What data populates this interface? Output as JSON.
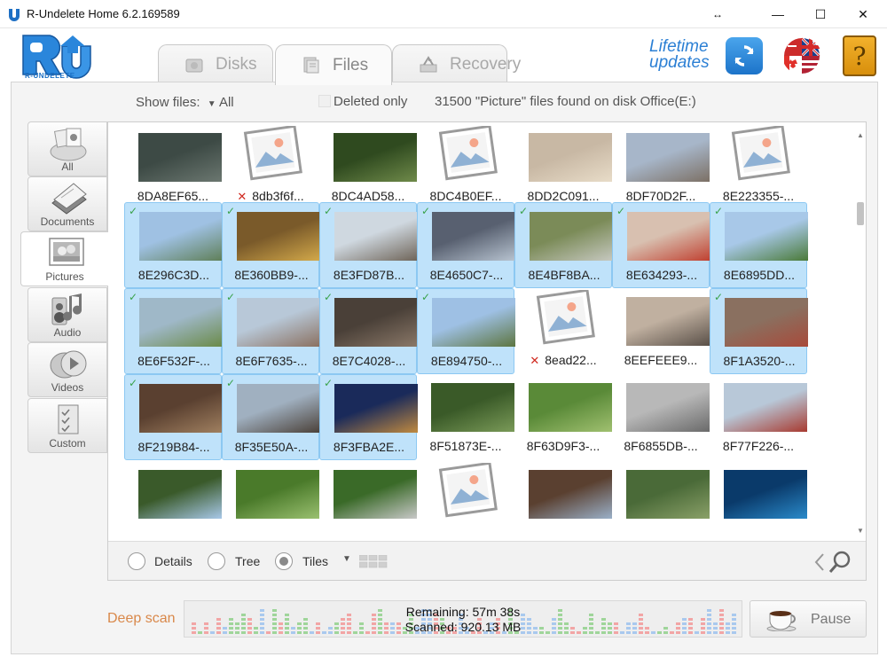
{
  "window": {
    "title": "R-Undelete Home 6.2.169589",
    "controls": {
      "restore_glyph": "↔",
      "minimize_glyph": "—",
      "maximize_glyph": "☐",
      "close_glyph": "✕"
    }
  },
  "header": {
    "logo_text": "R-UNDELETE",
    "tabs": [
      {
        "label": "Disks",
        "icon": "disk-icon",
        "active": false
      },
      {
        "label": "Files",
        "icon": "files-icon",
        "active": true
      },
      {
        "label": "Recovery",
        "icon": "recovery-icon",
        "active": false
      }
    ],
    "lifetime_line1": "Lifetime",
    "lifetime_line2": "updates",
    "help_glyph": "?"
  },
  "toolbar": {
    "show_files_label": "Show files:",
    "show_files_arrow": "▼",
    "show_files_value": "All",
    "deleted_only_label": "Deleted only",
    "deleted_only_checked": false,
    "status": "31500 \"Picture\" files found on disk Office(E:)"
  },
  "sidebar": {
    "items": [
      {
        "label": "All",
        "icon": "all-files-icon",
        "active": false
      },
      {
        "label": "Documents",
        "icon": "documents-icon",
        "active": false
      },
      {
        "label": "Pictures",
        "icon": "pictures-icon",
        "active": true
      },
      {
        "label": "Audio",
        "icon": "audio-icon",
        "active": false
      },
      {
        "label": "Videos",
        "icon": "videos-icon",
        "active": false
      },
      {
        "label": "Custom",
        "icon": "custom-icon",
        "active": false
      }
    ]
  },
  "files": [
    {
      "name": "8DA8EF65...",
      "selected": false,
      "deleted": false,
      "placeholder": false
    },
    {
      "name": "8db3f6f...",
      "selected": false,
      "deleted": true,
      "placeholder": true
    },
    {
      "name": "8DC4AD58...",
      "selected": false,
      "deleted": false,
      "placeholder": false
    },
    {
      "name": "8DC4B0EF...",
      "selected": false,
      "deleted": false,
      "placeholder": true
    },
    {
      "name": "8DD2C091...",
      "selected": false,
      "deleted": false,
      "placeholder": false
    },
    {
      "name": "8DF70D2F...",
      "selected": false,
      "deleted": false,
      "placeholder": false
    },
    {
      "name": "8E223355-...",
      "selected": false,
      "deleted": false,
      "placeholder": true
    },
    {
      "name": "8E296C3D...",
      "selected": true,
      "deleted": false,
      "placeholder": false
    },
    {
      "name": "8E360BB9-...",
      "selected": true,
      "deleted": false,
      "placeholder": false
    },
    {
      "name": "8E3FD87B...",
      "selected": true,
      "deleted": false,
      "placeholder": false
    },
    {
      "name": "8E4650C7-...",
      "selected": true,
      "deleted": false,
      "placeholder": false
    },
    {
      "name": "8E4BF8BA...",
      "selected": true,
      "deleted": false,
      "placeholder": false
    },
    {
      "name": "8E634293-...",
      "selected": true,
      "deleted": false,
      "placeholder": false
    },
    {
      "name": "8E6895DD...",
      "selected": true,
      "deleted": false,
      "placeholder": false
    },
    {
      "name": "8E6F532F-...",
      "selected": true,
      "deleted": false,
      "placeholder": false
    },
    {
      "name": "8E6F7635-...",
      "selected": true,
      "deleted": false,
      "placeholder": false
    },
    {
      "name": "8E7C4028-...",
      "selected": true,
      "deleted": false,
      "placeholder": false
    },
    {
      "name": "8E894750-...",
      "selected": true,
      "deleted": false,
      "placeholder": false
    },
    {
      "name": "8ead22...",
      "selected": false,
      "deleted": true,
      "placeholder": true
    },
    {
      "name": "8EEFEEE9...",
      "selected": false,
      "deleted": false,
      "placeholder": false
    },
    {
      "name": "8F1A3520-...",
      "selected": true,
      "deleted": false,
      "placeholder": false
    },
    {
      "name": "8F219B84-...",
      "selected": true,
      "deleted": false,
      "placeholder": false
    },
    {
      "name": "8F35E50A-...",
      "selected": true,
      "deleted": false,
      "placeholder": false
    },
    {
      "name": "8F3FBA2E...",
      "selected": true,
      "deleted": false,
      "placeholder": false
    },
    {
      "name": "8F51873E-...",
      "selected": false,
      "deleted": false,
      "placeholder": false
    },
    {
      "name": "8F63D9F3-...",
      "selected": false,
      "deleted": false,
      "placeholder": false
    },
    {
      "name": "8F6855DB-...",
      "selected": false,
      "deleted": false,
      "placeholder": false
    },
    {
      "name": "8F77F226-...",
      "selected": false,
      "deleted": false,
      "placeholder": false
    }
  ],
  "files_partial_row_count": 7,
  "thumb_palette": [
    [
      "#3d4a45",
      "#6b7770"
    ],
    [
      "#ffffff",
      "#ffffff"
    ],
    [
      "#2f4a1f",
      "#6f8a4a"
    ],
    [
      "#ffffff",
      "#ffffff"
    ],
    [
      "#c8b8a4",
      "#e8dcc8"
    ],
    [
      "#a7b6c9",
      "#7c7065"
    ],
    [
      "#ffffff",
      "#ffffff"
    ],
    [
      "#9fc1e3",
      "#5f7f58"
    ],
    [
      "#7a5a2a",
      "#d3a94a"
    ],
    [
      "#cfd8e0",
      "#6e6458"
    ],
    [
      "#586070",
      "#b7c3d0"
    ],
    [
      "#7b8b58",
      "#c6c8c0"
    ],
    [
      "#d8c0b0",
      "#c04030"
    ],
    [
      "#a8c8e8",
      "#4a7a38"
    ],
    [
      "#9fb8c8",
      "#6a8a48"
    ],
    [
      "#b8c8d8",
      "#8a7060"
    ],
    [
      "#4a4038",
      "#8a7868"
    ],
    [
      "#9ec0e4",
      "#5d7540"
    ],
    [
      "#ffffff",
      "#ffffff"
    ],
    [
      "#c0b0a0",
      "#5a5048"
    ],
    [
      "#8a7060",
      "#a84a3a"
    ],
    [
      "#5a4030",
      "#a08060"
    ],
    [
      "#a0b0c0",
      "#4a4038"
    ],
    [
      "#1a2a5a",
      "#c08a40"
    ],
    [
      "#3a5a28",
      "#7a9a58"
    ],
    [
      "#5a8a38",
      "#a0c070"
    ],
    [
      "#b8b8b8",
      "#6a6a6a"
    ],
    [
      "#b8c8d8",
      "#a83a30"
    ],
    [
      "#3a5a2a",
      "#a8c8e8"
    ],
    [
      "#4a7a2a",
      "#9ac070"
    ],
    [
      "#3a6a28",
      "#c8c8c8"
    ],
    [
      "#ffffff",
      "#ffffff"
    ],
    [
      "#5a4030",
      "#9ab0c8"
    ],
    [
      "#4a6a38",
      "#8aa068"
    ],
    [
      "#0a3a6a",
      "#2a8aca"
    ]
  ],
  "view": {
    "options": [
      {
        "label": "Details",
        "selected": false
      },
      {
        "label": "Tree",
        "selected": false
      },
      {
        "label": "Tiles",
        "selected": true
      }
    ],
    "size_arrow": "▼"
  },
  "scan": {
    "label": "Deep scan",
    "remaining": "Remaining: 57m 38s",
    "scanned": "Scanned: 920.13 MB",
    "pause_label": "Pause"
  },
  "colors": {
    "accent_blue": "#2b7fd4",
    "selection_bg": "#bfe2fa",
    "selection_border": "#8cc8f2",
    "deep_scan_orange": "#d9884a",
    "check_green": "#39a24a",
    "delete_red": "#d0291f"
  }
}
